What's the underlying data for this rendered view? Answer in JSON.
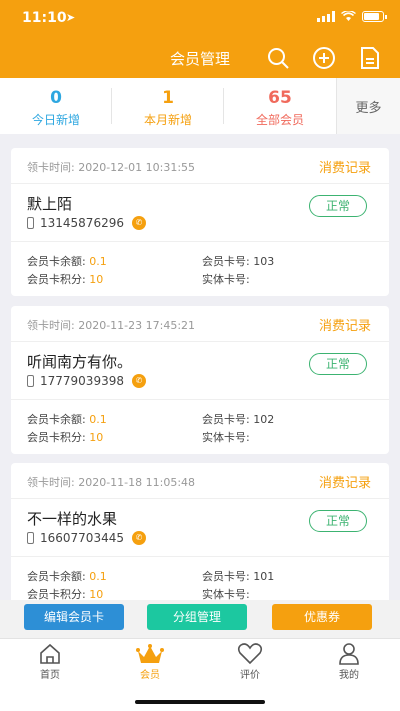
{
  "status_bar": {
    "time": "11:10"
  },
  "nav": {
    "title": "会员管理"
  },
  "stats": [
    {
      "value": "0",
      "label": "今日新增",
      "color": "#2ea7e0"
    },
    {
      "value": "1",
      "label": "本月新增",
      "color": "#f5a00f"
    },
    {
      "value": "65",
      "label": "全部会员",
      "color": "#f06a5c"
    }
  ],
  "more_label": "更多",
  "members": [
    {
      "card_time": "领卡时间: 2020-12-01 10:31:55",
      "link": "消费记录",
      "name": "默上陌",
      "phone": "13145876296",
      "status": "正常",
      "balance_label": "会员卡余额:",
      "balance": "0.1",
      "points_label": "会员卡积分:",
      "points": "10",
      "card_no_label": "会员卡号:",
      "card_no": "103",
      "physical_label": "实体卡号:",
      "physical": ""
    },
    {
      "card_time": "领卡时间: 2020-11-23 17:45:21",
      "link": "消费记录",
      "name": "听闻南方有你。",
      "phone": "17779039398",
      "status": "正常",
      "balance_label": "会员卡余额:",
      "balance": "0.1",
      "points_label": "会员卡积分:",
      "points": "10",
      "card_no_label": "会员卡号:",
      "card_no": "102",
      "physical_label": "实体卡号:",
      "physical": ""
    },
    {
      "card_time": "领卡时间: 2020-11-18 11:05:48",
      "link": "消费记录",
      "name": "不一样的水果",
      "phone": "16607703445",
      "status": "正常",
      "balance_label": "会员卡余额:",
      "balance": "0.1",
      "points_label": "会员卡积分:",
      "points": "10",
      "card_no_label": "会员卡号:",
      "card_no": "101",
      "physical_label": "实体卡号:",
      "physical": ""
    }
  ],
  "actions": [
    {
      "label": "编辑会员卡",
      "color": "#2d8fd6"
    },
    {
      "label": "分组管理",
      "color": "#1cc8a0"
    },
    {
      "label": "优惠券",
      "color": "#f5a00f"
    }
  ],
  "tabs": [
    {
      "label": "首页",
      "icon": "home-icon"
    },
    {
      "label": "会员",
      "icon": "crown-icon"
    },
    {
      "label": "评价",
      "icon": "heart-icon"
    },
    {
      "label": "我的",
      "icon": "person-icon"
    }
  ],
  "colors": {
    "accent": "#f5a00f",
    "status_ok": "#3cb371"
  }
}
